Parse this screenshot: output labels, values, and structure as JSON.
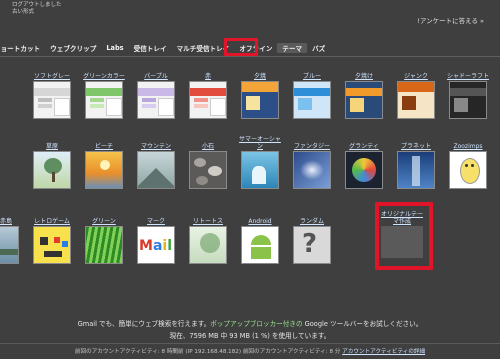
{
  "header": {
    "top_left_line1": "ログアウトしました",
    "top_left_line2": "古い形式",
    "top_right": "!アンケートに答える »"
  },
  "tabs": [
    "ショートカット",
    "ウェブクリップ",
    "Labs",
    "受信トレイ",
    "マルチ受信トレイ",
    "オフライン",
    "テーマ",
    "バズ"
  ],
  "active_tab": 6,
  "themes": [
    {
      "label": "ソフトグレー",
      "icon": "theme-softgray-icon"
    },
    {
      "label": "グリーンカラー",
      "icon": "theme-green-icon"
    },
    {
      "label": "パープル",
      "icon": "theme-purple-icon"
    },
    {
      "label": "赤",
      "icon": "theme-red-icon"
    },
    {
      "label": "夕焼",
      "icon": "theme-sunset-icon"
    },
    {
      "label": "ブルー",
      "icon": "theme-blue-icon"
    },
    {
      "label": "夕焼け",
      "icon": "theme-dusk-icon"
    },
    {
      "label": "ジャンク",
      "icon": "theme-orange-icon"
    },
    {
      "label": "シャドーラフト",
      "icon": "theme-shadow-icon"
    },
    {
      "label": "草原",
      "icon": "tree-icon"
    },
    {
      "label": "ビーチ",
      "icon": "beach-icon"
    },
    {
      "label": "マウンテン",
      "icon": "mountain-icon"
    },
    {
      "label": "小石",
      "icon": "pebbles-icon"
    },
    {
      "label": "サマーオーシャン",
      "icon": "ocean-icon"
    },
    {
      "label": "ファンタジー",
      "icon": "fantasy-icon"
    },
    {
      "label": "グランティ",
      "icon": "graffiti-icon"
    },
    {
      "label": "プラネット",
      "icon": "planet-icon"
    },
    {
      "label": "Zoozimps",
      "icon": "cartoon-icon"
    },
    {
      "label": "オル赤島",
      "icon": "lake-icon"
    },
    {
      "label": "レトロゲーム",
      "icon": "retro-game-icon"
    },
    {
      "label": "グリーン",
      "icon": "grass-icon"
    },
    {
      "label": "マーク",
      "icon": "mail-logo-icon"
    },
    {
      "label": "リトートス",
      "icon": "bamboo-icon"
    },
    {
      "label": "Android",
      "icon": "android-icon"
    },
    {
      "label": "ランダム",
      "icon": "question-icon"
    },
    {
      "label": "オリジナルテーマ作成",
      "icon": "custom-theme-icon"
    }
  ],
  "footer": {
    "line1_pre": "Gmail でも、簡単にウェブ検索を行えます。",
    "line1_link": "ポップアップブロッカー付きの",
    "line1_post": " Google ツールバーをお試しください。",
    "line2": "現在、7596 MB 中 93 MB (1 %) を使用しています。",
    "line3_pre": "前回のアカウントアクティビティ: 8 時間前 (IP 192.168.48.182)",
    "line3_mid": "  前回のアカウントアクティビティ: 8 分 ",
    "line3_link": "アカウントアクティビティの詳細"
  },
  "colors": {
    "highlight": "#e0152a",
    "background": "#3f3f3f",
    "link": "#cfe4ff"
  }
}
